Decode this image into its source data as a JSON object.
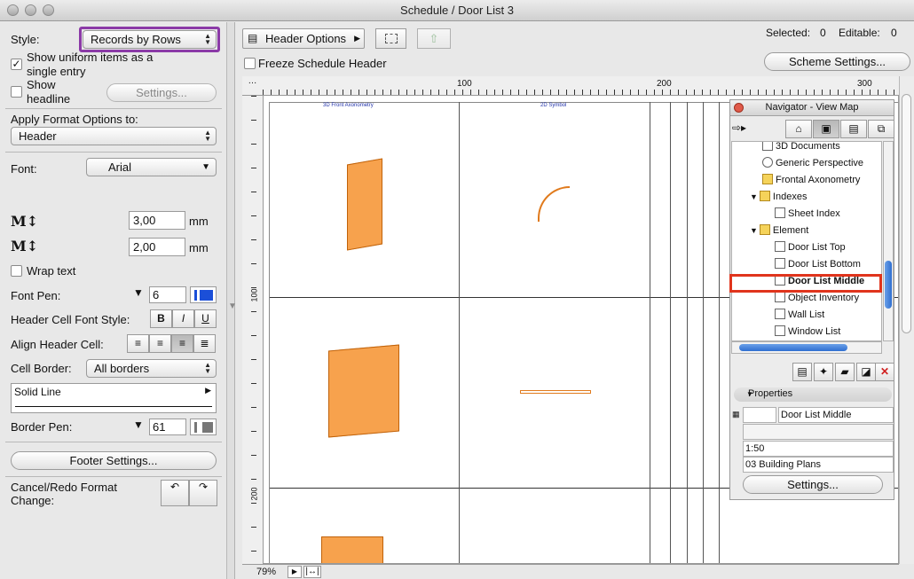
{
  "window": {
    "title": "Schedule /  Door List 3"
  },
  "left": {
    "style_label": "Style:",
    "style_value": "Records by Rows",
    "uniform_label": "Show uniform items as a single entry",
    "headline_label": "Show headline",
    "settings_button": "Settings...",
    "apply_label": "Apply Format Options to:",
    "apply_value": "Header",
    "font_label": "Font:",
    "font_value": "Arial",
    "size1_value": "3,00",
    "size2_value": "2,00",
    "unit": "mm",
    "wrap_label": "Wrap text",
    "fontpen_label": "Font Pen:",
    "fontpen_value": "6",
    "header_style_label": "Header Cell Font Style:",
    "bold": "B",
    "italic": "I",
    "underline": "U",
    "align_label": "Align Header Cell:",
    "border_label": "Cell Border:",
    "border_value": "All borders",
    "line_value": "Solid Line",
    "borderpen_label": "Border Pen:",
    "borderpen_value": "61",
    "footer_button": "Footer Settings...",
    "cancel_redo_label": "Cancel/Redo Format Change:"
  },
  "toolbar": {
    "header_options": "Header Options",
    "freeze_label": "Freeze Schedule Header",
    "selected_label": "Selected:",
    "selected_value": "0",
    "editable_label": "Editable:",
    "editable_value": "0",
    "scheme_button": "Scheme Settings..."
  },
  "ruler": {
    "h_ticks": [
      "100",
      "200",
      "300"
    ],
    "v_ticks": [
      "100",
      "200"
    ]
  },
  "table_headers": [
    "3D Front Axonometry",
    "2D Symbol"
  ],
  "navigator": {
    "title": "Navigator - View Map",
    "items": [
      "3D Documents",
      "Generic Perspective",
      "Frontal Axonometry",
      "Indexes",
      "Sheet Index",
      "Element",
      "Door List Top",
      "Door List Bottom",
      "Door List Middle",
      "Object Inventory",
      "Wall List",
      "Window List"
    ],
    "properties_label": "Properties",
    "prop_name": "Door List Middle",
    "prop_scale": "1:50",
    "prop_layer": "03 Building Plans",
    "settings_button": "Settings..."
  },
  "zoom": {
    "value": "79%"
  },
  "colors": {
    "highlight_purple": "#8b3aa7",
    "highlight_red": "#e0341c",
    "door_orange": "#f7a24d"
  }
}
